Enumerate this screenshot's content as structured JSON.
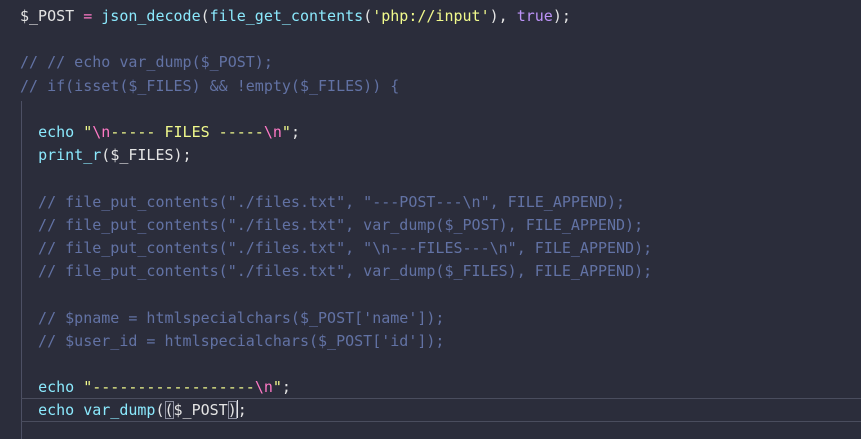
{
  "editor": {
    "language": "php",
    "theme_colors": {
      "background": "#2b2d3b",
      "variable": "#e4e4e4",
      "operator": "#ff79c6",
      "function": "#8be9fd",
      "string": "#f1fa8c",
      "constant": "#bd93f9",
      "comment": "#6272a4"
    },
    "lines": [
      [
        [
          "var",
          "$_POST"
        ],
        [
          "punc",
          " "
        ],
        [
          "op",
          "="
        ],
        [
          "punc",
          " "
        ],
        [
          "fn",
          "json_decode"
        ],
        [
          "punc",
          "("
        ],
        [
          "fn",
          "file_get_contents"
        ],
        [
          "punc",
          "("
        ],
        [
          "str",
          "'php://input'"
        ],
        [
          "punc",
          "), "
        ],
        [
          "kw",
          "true"
        ],
        [
          "punc",
          ");"
        ]
      ],
      [],
      [
        [
          "cmt",
          "// // echo var_dump($_POST);"
        ]
      ],
      [
        [
          "cmt",
          "// if(isset($_FILES) && !empty($_FILES)) {"
        ]
      ],
      [],
      [
        [
          "punc",
          "  "
        ],
        [
          "fn",
          "echo"
        ],
        [
          "punc",
          " "
        ],
        [
          "str",
          "\""
        ],
        [
          "esc",
          "\\n"
        ],
        [
          "str",
          "----- FILES -----"
        ],
        [
          "esc",
          "\\n"
        ],
        [
          "str",
          "\""
        ],
        [
          "punc",
          ";"
        ]
      ],
      [
        [
          "punc",
          "  "
        ],
        [
          "fn",
          "print_r"
        ],
        [
          "punc",
          "("
        ],
        [
          "var",
          "$_FILES"
        ],
        [
          "punc",
          ");"
        ]
      ],
      [],
      [
        [
          "cmt",
          "  // file_put_contents(\"./files.txt\", \"---POST---\\n\", FILE_APPEND);"
        ]
      ],
      [
        [
          "cmt",
          "  // file_put_contents(\"./files.txt\", var_dump($_POST), FILE_APPEND);"
        ]
      ],
      [
        [
          "cmt",
          "  // file_put_contents(\"./files.txt\", \"\\n---FILES---\\n\", FILE_APPEND);"
        ]
      ],
      [
        [
          "cmt",
          "  // file_put_contents(\"./files.txt\", var_dump($_FILES), FILE_APPEND);"
        ]
      ],
      [],
      [
        [
          "cmt",
          "  // $pname = htmlspecialchars($_POST['name']);"
        ]
      ],
      [
        [
          "cmt",
          "  // $user_id = htmlspecialchars($_POST['id']);"
        ]
      ],
      [],
      [
        [
          "punc",
          "  "
        ],
        [
          "fn",
          "echo"
        ],
        [
          "punc",
          " "
        ],
        [
          "str",
          "\"------------------"
        ],
        [
          "esc",
          "\\n"
        ],
        [
          "str",
          "\""
        ],
        [
          "punc",
          ";"
        ]
      ],
      [
        [
          "punc",
          "  "
        ],
        [
          "fn",
          "echo"
        ],
        [
          "punc",
          " "
        ],
        [
          "fn",
          "var_dump"
        ],
        [
          "punc",
          "("
        ],
        [
          "bm",
          "("
        ],
        [
          "var",
          "$_POST"
        ],
        [
          "bm",
          ")"
        ],
        [
          "caret",
          ""
        ],
        [
          "punc",
          ";"
        ]
      ]
    ]
  }
}
